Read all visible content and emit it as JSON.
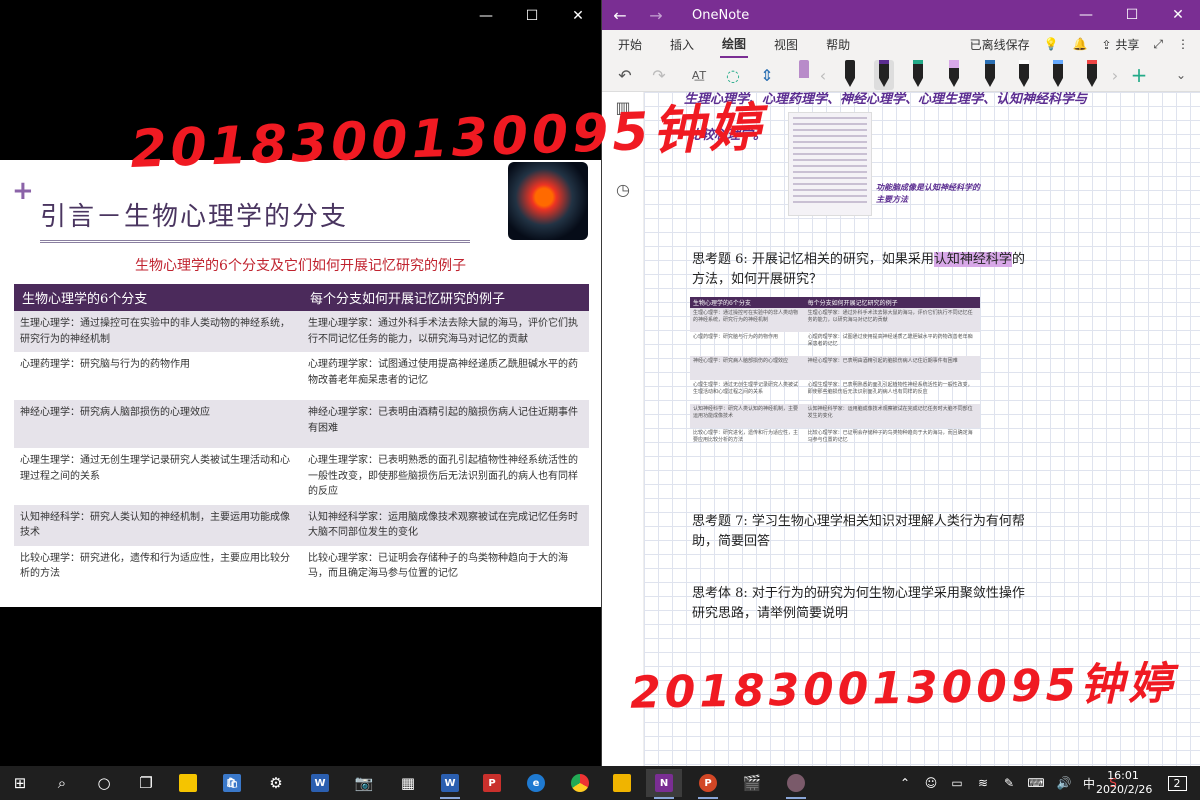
{
  "left_window": {
    "controls": {
      "minimize": "—",
      "maximize": "☐",
      "close": "✕"
    },
    "slide": {
      "title": "引言－生物心理学的分支",
      "subtitle": "生物心理学的6个分支及它们如何开展记忆研究的例子",
      "headers": [
        "生物心理学的6个分支",
        "每个分支如何开展记忆研究的例子"
      ],
      "rows": [
        [
          "生理心理学：通过操控可在实验中的非人类动物的神经系统，研究行为的神经机制",
          "生理心理学家：通过外科手术法去除大鼠的海马，评价它们执行不同记忆任务的能力，以研究海马对记忆的贡献"
        ],
        [
          "心理药理学：研究脑与行为的药物作用",
          "心理药理学家：试图通过使用提高神经递质乙酰胆碱水平的药物改善老年痴呆患者的记忆"
        ],
        [
          "神经心理学：研究病人脑部损伤的心理效应",
          "神经心理学家：已表明由酒精引起的脑损伤病人记住近期事件有困难"
        ],
        [
          "心理生理学：通过无创生理学记录研究人类被试生理活动和心理过程之间的关系",
          "心理生理学家：已表明熟悉的面孔引起植物性神经系统活性的一般性改变，即使那些脑损伤后无法识别面孔的病人也有同样的反应"
        ],
        [
          "认知神经科学：研究人类认知的神经机制，主要运用功能成像技术",
          "认知神经科学家：运用脑成像技术观察被试在完成记忆任务时大脑不同部位发生的变化"
        ],
        [
          "比较心理学：研究进化，遗传和行为适应性，主要应用比较分析的方法",
          "比较心理学家：已证明会存储种子的鸟类物种趋向于大的海马，而且确定海马参与位置的记忆"
        ]
      ]
    },
    "handwriting": "2018300130095钟婷"
  },
  "onenote": {
    "title": "OneNote",
    "nav": {
      "back": "←",
      "forward": "→"
    },
    "controls": {
      "minimize": "—",
      "maximize": "☐",
      "close": "✕"
    },
    "tabs": [
      "开始",
      "插入",
      "绘图",
      "视图",
      "帮助"
    ],
    "active_tab": "绘图",
    "status": "已离线保存",
    "share": "共享",
    "ink_line1": "生理心理学、心理药理学、神经心理学、心理生理学、认知神经科学与",
    "ink_line2": "比较心理学。",
    "ink_note": "功能脑成像是认知神经科学的主要方法",
    "q6_line1_pre": "思考题 6: 开展记忆相关的研究，如果采用",
    "q6_highlight": "认知神经科学",
    "q6_line1_post": "的",
    "q6_line2": "方法，如何开展研究？",
    "mini_table_headers": [
      "生物心理学的6个分支",
      "每个分支如何开展记忆研究的例子"
    ],
    "q7_line1": "思考题 7: 学习生物心理学相关知识对理解人类行为有何帮",
    "q7_line2": "助，简要回答",
    "q8_line1": "思考体 8: 对于行为的研究为何生物心理学采用聚敛性操作",
    "q8_line2": "研究思路，请举例简要说明",
    "handwriting": "2018300130095钟婷",
    "colors": {
      "accent": "#7a2e93",
      "ink": "#5b2d91",
      "handwriting": "#f01a22"
    }
  },
  "taskbar": {
    "clock_time": "16:01",
    "clock_date": "2020/2/26",
    "ime": "中",
    "notification_count": "2",
    "apps": [
      "start-icon",
      "search-icon",
      "cortana-icon",
      "task-view-icon",
      "sticky-notes-icon",
      "store-icon",
      "settings-icon",
      "word-icon",
      "camera-icon",
      "calendar-icon",
      "word-icon",
      "pdf-icon",
      "edge-icon",
      "chrome-icon",
      "file-explorer-icon",
      "onenote-icon",
      "powerpoint-icon",
      "video-editor-icon",
      "photo-icon"
    ]
  }
}
